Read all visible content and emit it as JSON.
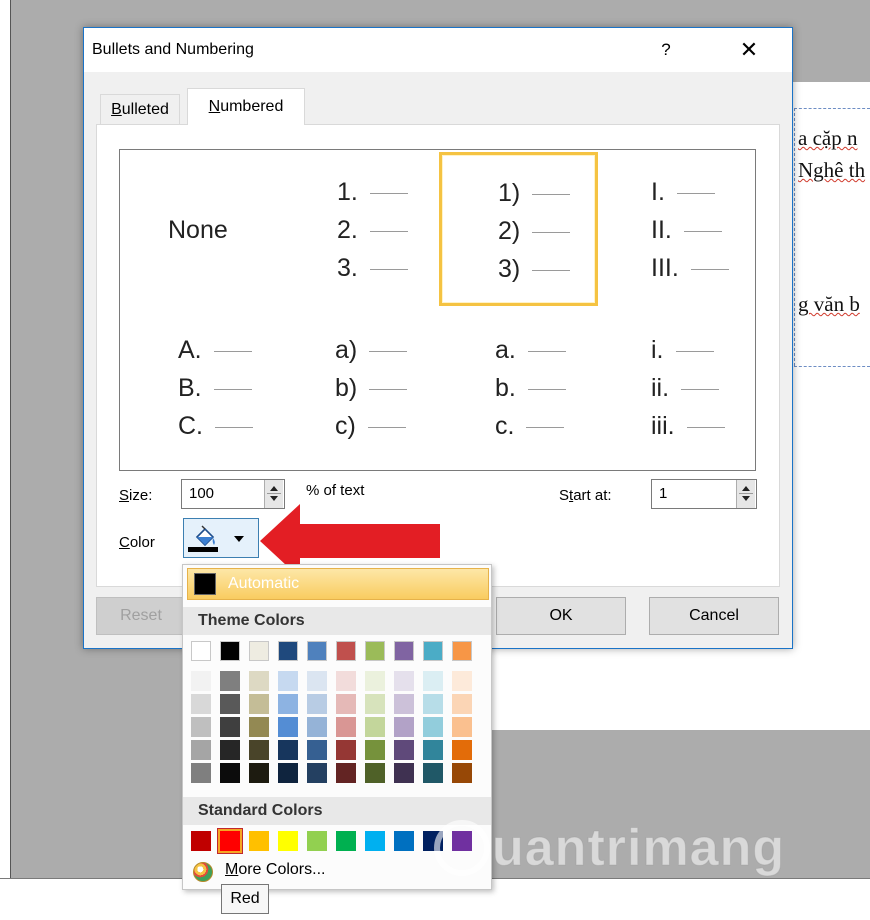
{
  "document": {
    "lines": [
      "a cặp n",
      "Nghê th",
      "g văn b"
    ]
  },
  "dialog": {
    "title": "Bullets and Numbering",
    "help": "?",
    "close": "✕",
    "tabs": [
      {
        "pre": "",
        "u": "B",
        "post": "ulleted"
      },
      {
        "pre": "",
        "u": "N",
        "post": "umbered"
      }
    ],
    "gallery": {
      "none_label": "None",
      "cells": [
        [
          "1.",
          "2.",
          "3."
        ],
        [
          "1)",
          "2)",
          "3)"
        ],
        [
          "I.",
          "II.",
          "III."
        ],
        [
          "A.",
          "B.",
          "C."
        ],
        [
          "a)",
          "b)",
          "c)"
        ],
        [
          "a.",
          "b.",
          "c."
        ],
        [
          "i.",
          "ii.",
          "iii."
        ]
      ]
    },
    "size_label": {
      "u": "S",
      "post": "ize:"
    },
    "size_value": "100",
    "size_suffix": "% of text",
    "start_label": {
      "pre": "S",
      "u": "t",
      "post": "art at:"
    },
    "start_value": "1",
    "color_label": {
      "u": "C",
      "post": "olor"
    },
    "buttons": {
      "reset": "Reset",
      "ok": "OK",
      "cancel": "Cancel"
    }
  },
  "palette": {
    "automatic": "Automatic",
    "theme_header": "Theme Colors",
    "standard_header": "Standard Colors",
    "more_colors": {
      "u": "M",
      "post": "ore Colors..."
    },
    "tooltip": "Red",
    "theme_base": [
      "#ffffff",
      "#000000",
      "#eeece1",
      "#1f497d",
      "#4f81bd",
      "#c0504d",
      "#9bbb59",
      "#8064a2",
      "#4bacc6",
      "#f79646"
    ],
    "theme_shades": [
      [
        "#f2f2f2",
        "#d8d8d8",
        "#bfbfbf",
        "#a5a5a5",
        "#7f7f7f"
      ],
      [
        "#7f7f7f",
        "#595959",
        "#3f3f3f",
        "#262626",
        "#0c0c0c"
      ],
      [
        "#ddd9c3",
        "#c4bd97",
        "#938953",
        "#494429",
        "#1d1b10"
      ],
      [
        "#c6d9f0",
        "#8db3e2",
        "#548dd4",
        "#17365d",
        "#0f243e"
      ],
      [
        "#dbe5f1",
        "#b8cce4",
        "#95b3d7",
        "#366092",
        "#244061"
      ],
      [
        "#f2dcdb",
        "#e5b9b7",
        "#d99694",
        "#953734",
        "#632423"
      ],
      [
        "#ebf1dd",
        "#d7e3bc",
        "#c3d69b",
        "#76923c",
        "#4f6128"
      ],
      [
        "#e5e0ec",
        "#ccc1d9",
        "#b2a2c7",
        "#5f497a",
        "#3f3151"
      ],
      [
        "#dbeef3",
        "#b7dde8",
        "#92cddc",
        "#31859b",
        "#205867"
      ],
      [
        "#fdeada",
        "#fbd5b5",
        "#fac08f",
        "#e36c09",
        "#974806"
      ]
    ],
    "standard": [
      "#c00000",
      "#ff0000",
      "#ffc000",
      "#ffff00",
      "#92d050",
      "#00b050",
      "#00b0f0",
      "#0070c0",
      "#002060",
      "#7030a0"
    ]
  },
  "watermark": "uantrimang"
}
